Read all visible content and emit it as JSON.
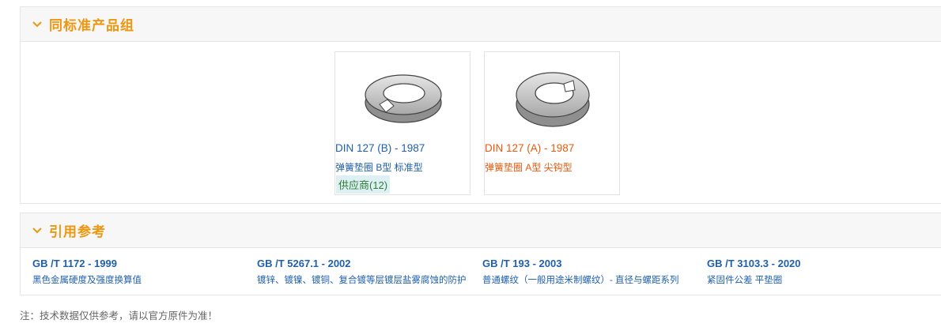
{
  "same_standard_group": {
    "title": "同标准产品组",
    "products": [
      {
        "standard": "DIN 127 (B) - 1987",
        "description": "弹簧垫圈 B型 标准型",
        "supplier": "供应商(12)",
        "image": "spring-washer-type-b-icon",
        "color": "#1f5fad"
      },
      {
        "standard": "DIN 127 (A) - 1987",
        "description": "弹簧垫圈 A型 尖钩型",
        "image": "spring-washer-type-a-icon",
        "color": "#e8590c"
      }
    ]
  },
  "references": {
    "title": "引用参考",
    "items": [
      {
        "code": "GB /T 1172 - 1999",
        "name": "黑色金属硬度及强度换算值"
      },
      {
        "code": "GB /T 5267.1 - 2002",
        "name": "镀锌、镀镍、镀铜、复合镀等层镀层盐雾腐蚀的防护"
      },
      {
        "code": "GB /T 193 - 2003",
        "name": "普通螺纹（一般用途米制螺纹）- 直径与螺距系列"
      },
      {
        "code": "GB /T 3103.3 - 2020",
        "name": "紧固件公差 平垫圈"
      }
    ]
  },
  "note": "注：技术数据仅供参考，请以官方原件为准！",
  "colors": {
    "accent": "#f0960e",
    "link": "#1f5fad",
    "active": "#e8590c",
    "supplier": "#2e7d32"
  }
}
